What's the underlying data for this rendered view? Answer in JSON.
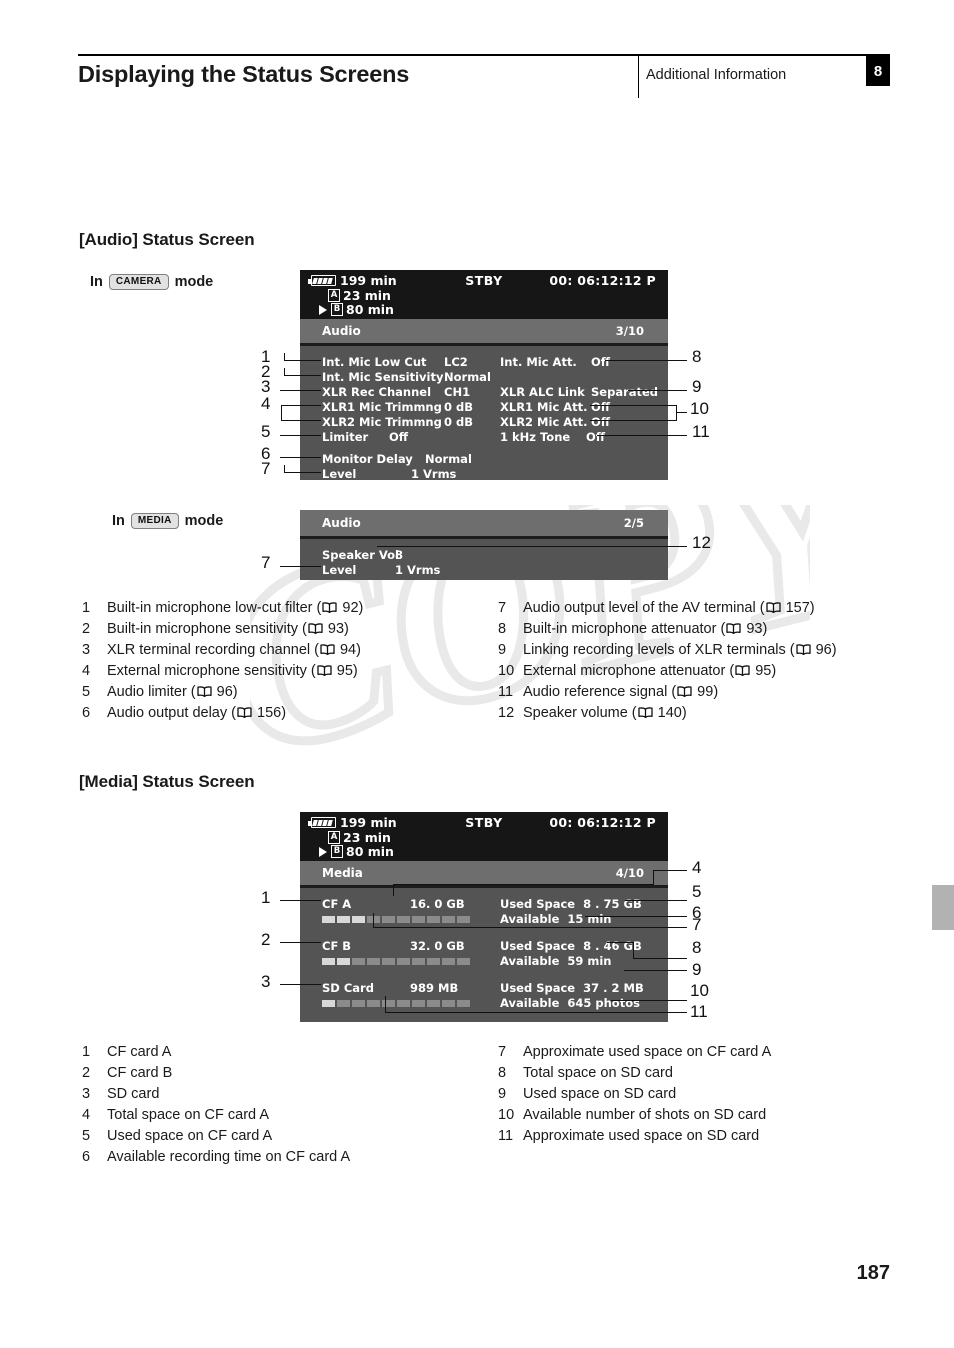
{
  "header": {
    "title": "Displaying the Status Screens",
    "subtitle": "Additional Information",
    "chapter": "8"
  },
  "page_number": "187",
  "sections": {
    "audio": {
      "heading": "[Audio] Status Screen",
      "camera_mode": {
        "prefix": "In",
        "badge": "CAMERA",
        "suffix": "mode"
      },
      "media_mode": {
        "prefix": "In",
        "badge": "MEDIA",
        "suffix": "mode"
      }
    },
    "media": {
      "heading": "[Media] Status Screen"
    }
  },
  "osd_statusbar": {
    "battery_icon": "battery-icon",
    "battery_time": "199 min",
    "rec_status": "STBY",
    "timecode": "00: 06:12:12 P",
    "card_a_icon": "A",
    "card_a_time": "23 min",
    "card_b_icon": "B",
    "card_b_time": "80 min",
    "play_icon": "play-triangle-icon"
  },
  "audio_screen_camera": {
    "title": "Audio",
    "page_indicator": "3/10",
    "rows_left": [
      {
        "label": "Int.  Mic Low Cut",
        "value": "LC2"
      },
      {
        "label": "Int.  Mic Sensitivity",
        "value": "Normal"
      },
      {
        "label": "XLR Rec Channel",
        "value": "CH1"
      },
      {
        "label": "XLR1 Mic Trimmng",
        "value": "0 dB"
      },
      {
        "label": "XLR2 Mic Trimmng",
        "value": "0 dB"
      },
      {
        "label": "Limiter",
        "value": "Off"
      },
      {
        "label": "Monitor Delay",
        "value": "Normal"
      },
      {
        "label": "Level",
        "value": "1 Vrms"
      }
    ],
    "rows_right": [
      {
        "label": "Int.  Mic Att.",
        "value": "Off"
      },
      {
        "label": "XLR ALC Link",
        "value": "Separated"
      },
      {
        "label": "XLR1 Mic Att.",
        "value": "Off"
      },
      {
        "label": "XLR2 Mic Att.",
        "value": "Off"
      },
      {
        "label": "1 kHz Tone",
        "value": "Off"
      }
    ]
  },
  "audio_screen_media": {
    "title": "Audio",
    "page_indicator": "2/5",
    "rows": [
      {
        "label": "Speaker Vol",
        "value": "8"
      },
      {
        "label": "Level",
        "value": "1 Vrms"
      }
    ]
  },
  "media_screen": {
    "title": "Media",
    "page_indicator": "4/10",
    "cards": [
      {
        "name": "CF A",
        "total": "16. 0 GB",
        "used_label": "Used Space",
        "used_value": "8 . 75 GB",
        "available_label": "Available",
        "available_value": "15 min",
        "gauge_filled": 3,
        "gauge_total": 10
      },
      {
        "name": "CF B",
        "total": "32. 0 GB",
        "used_label": "Used Space",
        "used_value": "8 . 46 GB",
        "available_label": "Available",
        "available_value": "59 min",
        "gauge_filled": 2,
        "gauge_total": 10
      },
      {
        "name": "SD Card",
        "total": "989 MB",
        "used_label": "Used Space",
        "used_value": "37 . 2 MB",
        "available_label": "Available",
        "available_value": "645 photos",
        "gauge_filled": 1,
        "gauge_total": 10
      }
    ]
  },
  "audio_callouts": {
    "left": [
      "1",
      "2",
      "3",
      "4",
      "5",
      "6",
      "7"
    ],
    "right": [
      "8",
      "9",
      "10",
      "11"
    ],
    "media_mode_left": [
      "7"
    ],
    "media_mode_right": [
      "12"
    ]
  },
  "media_callouts": {
    "left": [
      "1",
      "2",
      "3"
    ],
    "right": [
      "4",
      "5",
      "6",
      "7",
      "8",
      "9",
      "10",
      "11"
    ]
  },
  "audio_legend_left": [
    {
      "n": "1",
      "text_before": "Built-in microphone low-cut filter (",
      "page": "92",
      "text_after": ")"
    },
    {
      "n": "2",
      "text_before": "Built-in microphone sensitivity (",
      "page": "93",
      "text_after": ")"
    },
    {
      "n": "3",
      "text_before": "XLR terminal recording channel (",
      "page": "94",
      "text_after": ")"
    },
    {
      "n": "4",
      "text_before": "External microphone sensitivity (",
      "page": "95",
      "text_after": ")"
    },
    {
      "n": "5",
      "text_before": "Audio limiter (",
      "page": "96",
      "text_after": ")"
    },
    {
      "n": "6",
      "text_before": "Audio output delay (",
      "page": "156",
      "text_after": ")"
    }
  ],
  "audio_legend_right": [
    {
      "n": "7",
      "text_before": "Audio output level of the AV terminal (",
      "page": "157",
      "text_after": ")"
    },
    {
      "n": "8",
      "text_before": "Built-in microphone attenuator (",
      "page": "93",
      "text_after": ")"
    },
    {
      "n": "9",
      "text_before": "Linking recording levels of XLR terminals (",
      "page": "96",
      "text_after": ")"
    },
    {
      "n": "10",
      "text_before": "External microphone attenuator (",
      "page": "95",
      "text_after": ")"
    },
    {
      "n": "11",
      "text_before": "Audio reference signal (",
      "page": "99",
      "text_after": ")"
    },
    {
      "n": "12",
      "text_before": "Speaker volume (",
      "page": "140",
      "text_after": ")"
    }
  ],
  "media_legend_left": [
    {
      "n": "1",
      "text_before": "CF card A",
      "page": "",
      "text_after": ""
    },
    {
      "n": "2",
      "text_before": "CF card B",
      "page": "",
      "text_after": ""
    },
    {
      "n": "3",
      "text_before": "SD card",
      "page": "",
      "text_after": ""
    },
    {
      "n": "4",
      "text_before": "Total space on CF card A",
      "page": "",
      "text_after": ""
    },
    {
      "n": "5",
      "text_before": "Used space on CF card A",
      "page": "",
      "text_after": ""
    },
    {
      "n": "6",
      "text_before": "Available recording time on CF card A",
      "page": "",
      "text_after": ""
    }
  ],
  "media_legend_right": [
    {
      "n": "7",
      "text_before": "Approximate used space on CF card A",
      "page": "",
      "text_after": ""
    },
    {
      "n": "8",
      "text_before": "Total space on SD card",
      "page": "",
      "text_after": ""
    },
    {
      "n": "9",
      "text_before": "Used space on SD card",
      "page": "",
      "text_after": ""
    },
    {
      "n": "10",
      "text_before": "Available number of shots on SD card",
      "page": "",
      "text_after": ""
    },
    {
      "n": "11",
      "text_before": "Approximate used space on SD card",
      "page": "",
      "text_after": ""
    }
  ],
  "watermark": {
    "text": "COPY",
    "color": "#e8e8e8"
  },
  "colors": {
    "osd_body": "#545454",
    "osd_topbar": "#161616",
    "osd_titlebar": "#6e6e6e",
    "gauge_on": "#d8d8d8",
    "gauge_off": "#8b8b8b",
    "chapter_badge": "#000000",
    "side_tab": "#b2b2b2"
  }
}
